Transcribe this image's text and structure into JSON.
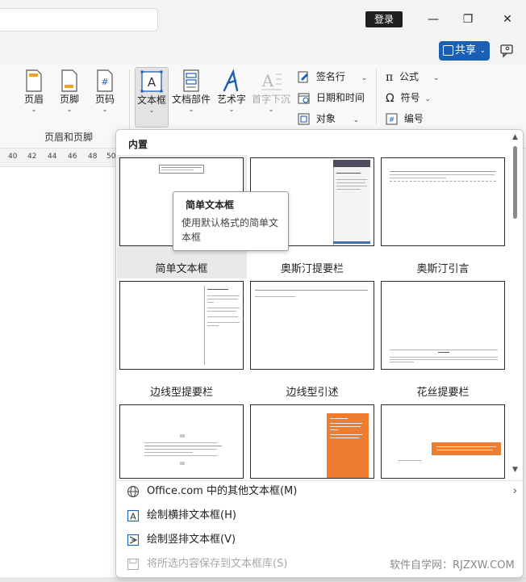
{
  "titlebar": {
    "login_label": "登录",
    "minimize": "—",
    "restore": "❐",
    "close": "✕"
  },
  "share": {
    "label": "共享",
    "chevron": "⌄"
  },
  "ribbon": {
    "header_label": "页眉",
    "footer_label": "页脚",
    "page_number_label": "页码",
    "header_footer_group": "页眉和页脚",
    "textbox_label": "文本框",
    "quickparts_label": "文档部件",
    "wordart_label": "艺术字",
    "dropcap_label": "首字下沉",
    "signature_label": "签名行",
    "datetime_label": "日期和时间",
    "object_label": "对象",
    "equation_label": "公式",
    "symbol_label": "符号",
    "number_label": "编号",
    "dropdown_arrow": "⌄"
  },
  "ruler": {
    "ticks": [
      "40",
      "42",
      "44",
      "46",
      "48",
      "50"
    ]
  },
  "gallery": {
    "section_title": "内置",
    "tiles": [
      {
        "label": "简单文本框"
      },
      {
        "label": "奥斯汀提要栏"
      },
      {
        "label": "奥斯汀引言"
      },
      {
        "label": "边线型提要栏"
      },
      {
        "label": "边线型引述"
      },
      {
        "label": "花丝提要栏"
      }
    ],
    "accent_color": "#ed7d31"
  },
  "tooltip": {
    "title": "简单文本框",
    "description": "使用默认格式的简单文本框"
  },
  "menu": {
    "more_online": "Office.com 中的其他文本框(M)",
    "draw_horizontal": "绘制横排文本框(H)",
    "draw_vertical": "绘制竖排文本框(V)",
    "save_selection": "将所选内容保存到文本框库(S)"
  },
  "watermark": "软件自学网：RJZXW.COM"
}
